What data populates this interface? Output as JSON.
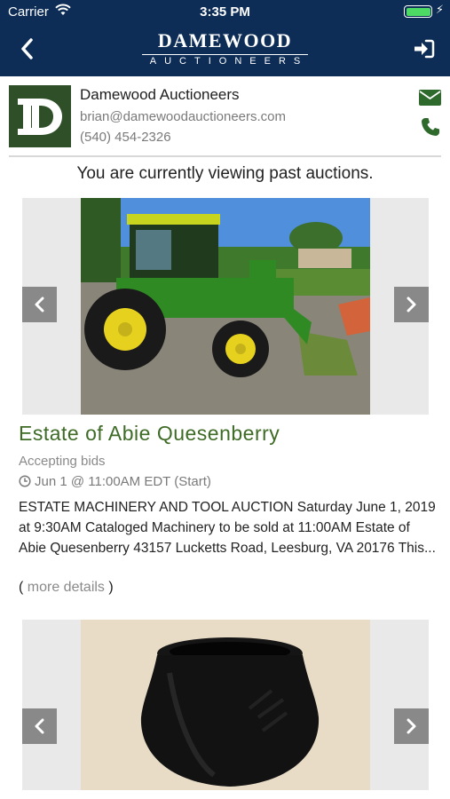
{
  "status_bar": {
    "carrier": "Carrier",
    "time": "3:35 PM"
  },
  "nav": {
    "logo_line1": "DAMEWOOD",
    "logo_line2": "AUCTIONEERS",
    "back_icon": "chevron-left-icon",
    "login_icon": "sign-in-icon"
  },
  "company": {
    "avatar_letter": "D",
    "name": "Damewood Auctioneers",
    "email": "brian@damewoodauctioneers.com",
    "phone": "(540) 454-2326"
  },
  "notice": "You are currently viewing past auctions.",
  "auctions": [
    {
      "title": "Estate of Abie Quesenberry",
      "status": "Accepting bids",
      "date": "Jun 1 @ 11:00AM EDT (Start)",
      "description": "ESTATE MACHINERY AND TOOL AUCTION Saturday June 1, 2019 at 9:30AM Cataloged Machinery to be sold at 11:00AM Estate of Abie Quesenberry 43157 Lucketts Road, Leesburg, VA 20176 This...",
      "more_open": "( ",
      "more_label": "more details",
      "more_close": " )"
    },
    {
      "title": "",
      "status": ""
    }
  ],
  "colors": {
    "brand_navy": "#0d2d57",
    "accent_green": "#3e6b25",
    "icon_green": "#2e6a2c"
  }
}
